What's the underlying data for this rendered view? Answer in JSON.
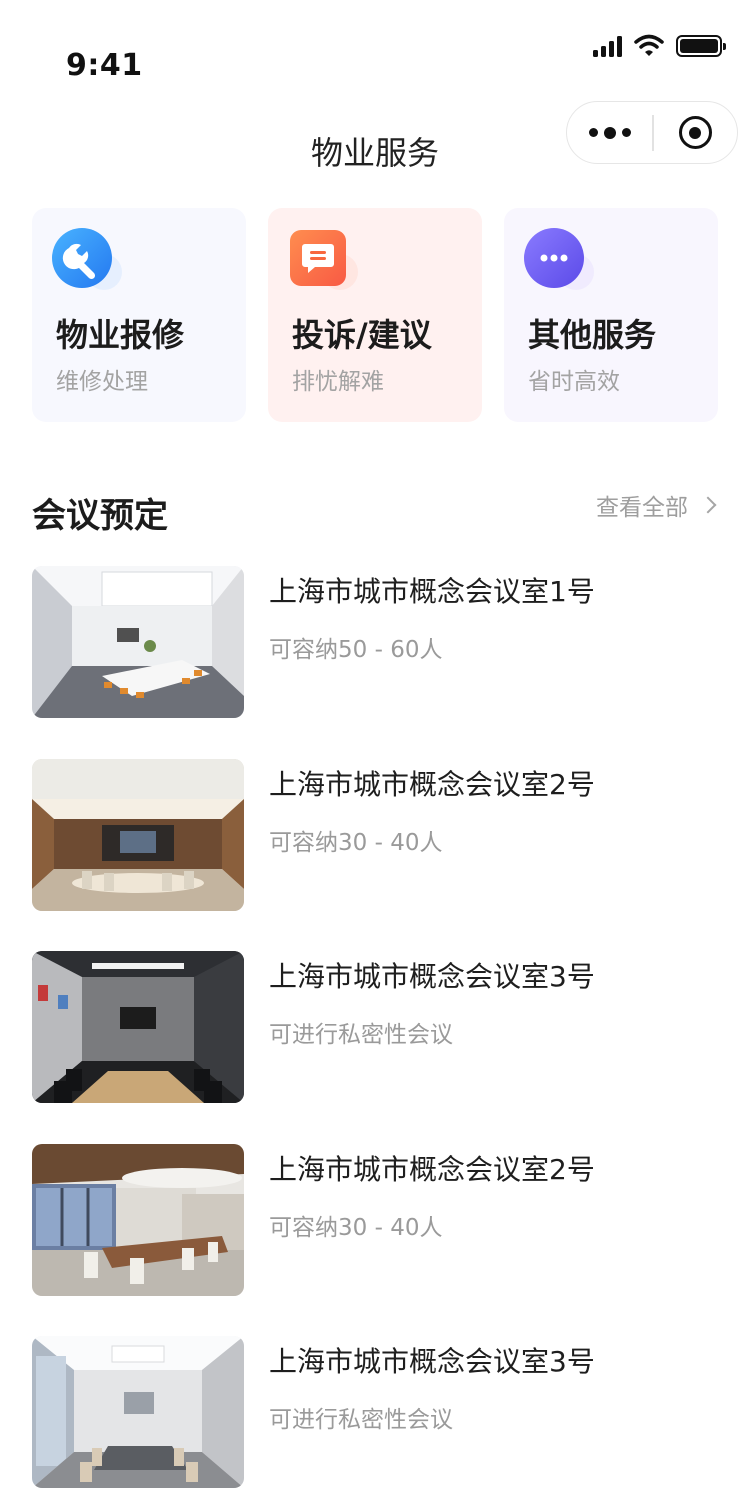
{
  "status_bar": {
    "time": "9:41"
  },
  "nav": {
    "title": "物业服务"
  },
  "services": [
    {
      "title": "物业报修",
      "subtitle": "维修处理",
      "icon": "wrench-icon",
      "color": "#2f8ff5"
    },
    {
      "title": "投诉/建议",
      "subtitle": "排忧解难",
      "icon": "message-icon",
      "color": "#fb6a44"
    },
    {
      "title": "其他服务",
      "subtitle": "省时高效",
      "icon": "more-dots-icon",
      "color": "#6a5ef0"
    }
  ],
  "meeting": {
    "section_title": "会议预定",
    "view_all_label": "查看全部",
    "rooms": [
      {
        "name": "上海市城市概念会议室1号",
        "desc": "可容纳50 - 60人"
      },
      {
        "name": "上海市城市概念会议室2号",
        "desc": "可容纳30 - 40人"
      },
      {
        "name": "上海市城市概念会议室3号",
        "desc": "可进行私密性会议"
      },
      {
        "name": "上海市城市概念会议室2号",
        "desc": "可容纳30 - 40人"
      },
      {
        "name": "上海市城市概念会议室3号",
        "desc": "可进行私密性会议"
      }
    ]
  }
}
